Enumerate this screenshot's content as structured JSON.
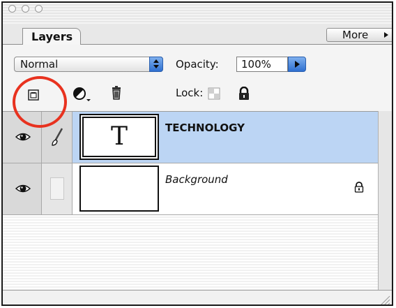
{
  "window": {
    "title": ""
  },
  "tabs": [
    {
      "label": "Layers"
    }
  ],
  "panel_menu": {
    "label": "More"
  },
  "blend_mode": {
    "value": "Normal"
  },
  "opacity": {
    "label": "Opacity:",
    "value": "100%"
  },
  "lock": {
    "label": "Lock:"
  },
  "layers": [
    {
      "name": "TECHNOLOGY",
      "thumbnail_text": "T",
      "selected": true,
      "visible": true,
      "type": "text"
    },
    {
      "name": "Background",
      "thumbnail_text": "",
      "selected": false,
      "visible": true,
      "locked": true
    }
  ],
  "icons": [
    "add-layer-style-icon",
    "adjustment-layer-icon",
    "delete-layer-icon",
    "lock-transparency-icon",
    "lock-all-icon",
    "eye-icon",
    "brush-icon",
    "lock-icon",
    "resize-grip-icon"
  ],
  "colors": {
    "selection": "#bcd5f4",
    "accent_blue": "#2e6fd0",
    "annotation_red": "#e8321f"
  }
}
